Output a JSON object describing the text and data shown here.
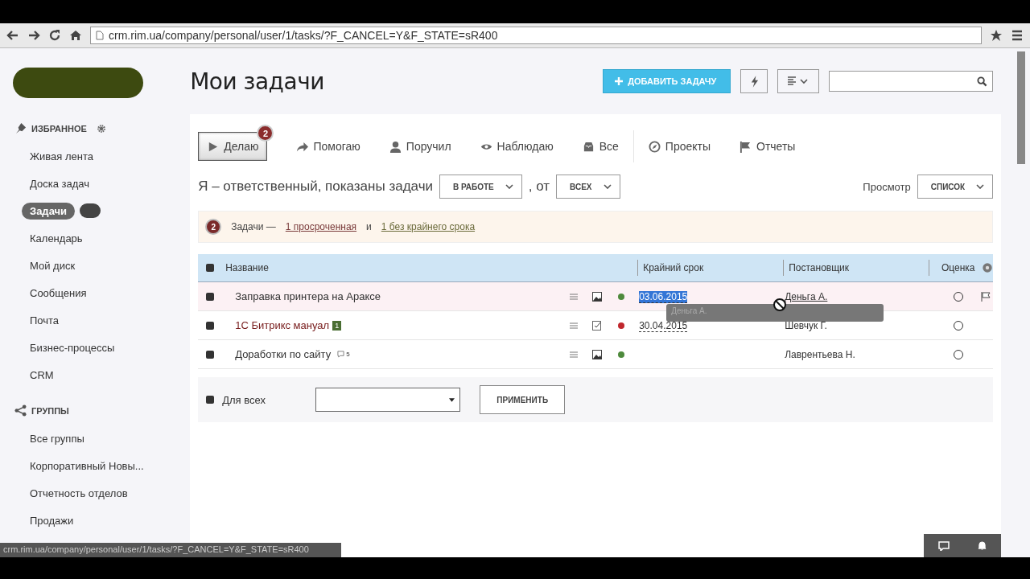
{
  "browser": {
    "url": "crm.rim.ua/company/personal/user/1/tasks/?F_CANCEL=Y&F_STATE=sR400"
  },
  "sidebar": {
    "sections": [
      {
        "title": "ИЗБРАННОЕ",
        "kind": "favorites",
        "items": [
          {
            "label": "Живая лента",
            "selected": false
          },
          {
            "label": "Доска задач",
            "selected": false
          },
          {
            "label": "Задачи",
            "selected": true
          },
          {
            "label": "Календарь",
            "selected": false
          },
          {
            "label": "Мой диск",
            "selected": false
          },
          {
            "label": "Сообщения",
            "selected": false
          },
          {
            "label": "Почта",
            "selected": false
          },
          {
            "label": "Бизнес-процессы",
            "selected": false
          },
          {
            "label": "CRM",
            "selected": false
          }
        ]
      },
      {
        "title": "ГРУППЫ",
        "kind": "groups",
        "items": [
          {
            "label": "Все группы",
            "selected": false
          },
          {
            "label": "Корпоративный Новы...",
            "selected": false
          },
          {
            "label": "Отчетность отделов",
            "selected": false
          },
          {
            "label": "Продажи",
            "selected": false
          }
        ]
      }
    ]
  },
  "page": {
    "title": "Мои задачи",
    "add_button": "ДОБАВИТЬ ЗАДАЧУ"
  },
  "tabs": [
    {
      "label": "Делаю",
      "selected": true,
      "badge": "2"
    },
    {
      "label": "Помогаю",
      "selected": false
    },
    {
      "label": "Поручил",
      "selected": false
    },
    {
      "label": "Наблюдаю",
      "selected": false
    },
    {
      "label": "Все",
      "selected": false
    },
    {
      "label": "Проекты",
      "selected": false
    },
    {
      "label": "Отчеты",
      "selected": false
    }
  ],
  "filter": {
    "prefix": "Я – ответственный, показаны задачи",
    "status": "В РАБОТЕ",
    "middle": ", от",
    "from": "ВСЕХ",
    "view_label": "Просмотр",
    "view": "СПИСОК"
  },
  "notice": {
    "badge": "2",
    "text": "Задачи —",
    "link1": "1 просроченная",
    "and": "и",
    "link2": "1 без крайнего срока"
  },
  "table": {
    "header_checked": false,
    "columns": [
      "Название",
      "Крайний срок",
      "Постановщик",
      "Оценка"
    ],
    "rows": [
      {
        "title": "Заправка принтера на Араксе",
        "checked": false,
        "overdue": false,
        "highlighted": true,
        "kind": "image",
        "color": "#4e8a3c",
        "deadline": "03.06.2015",
        "creator": "Деньга А.",
        "flagged": true
      },
      {
        "title": "1С Битрикс мануал",
        "checked": false,
        "overdue": true,
        "highlighted": false,
        "kind": "checklist",
        "color": "#c0272d",
        "deadline": "30.04.2015",
        "creator": "Шевчук Г.",
        "flagged": false,
        "extra": {
          "kind": "badge",
          "text": "1"
        }
      },
      {
        "title": "Доработки по сайту",
        "checked": false,
        "overdue": false,
        "highlighted": false,
        "kind": "image",
        "color": "#4e8a3c",
        "creator": "Лаврентьева Н.",
        "flagged": false,
        "extra": {
          "kind": "comments",
          "text": "5"
        }
      }
    ],
    "footer": {
      "checked": false,
      "label": "Для всех",
      "apply": "ПРИМЕНИТЬ"
    }
  },
  "tooltip": {
    "text": "Деньга А."
  },
  "status_bar": {
    "text": "crm.rim.ua/company/personal/user/1/tasks/?F_CANCEL=Y&F_STATE=sR400"
  }
}
